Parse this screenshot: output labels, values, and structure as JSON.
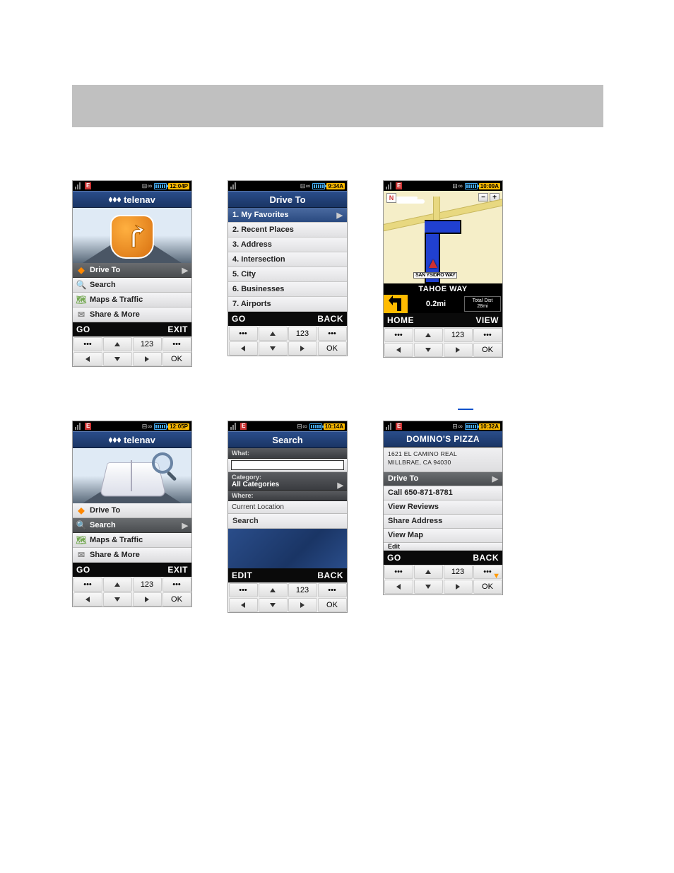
{
  "status": {
    "e_label": "E",
    "dev_icons": "⊟ ∞",
    "times": {
      "p1": "12:04P",
      "p2": "9:34A",
      "p3": "10:09A",
      "p4": "12:05P",
      "p5": "10:14A",
      "p6": "10:32A"
    }
  },
  "brand": "telenav",
  "main_menu": {
    "drive_to": "Drive To",
    "search": "Search",
    "maps": "Maps & Traffic",
    "share": "Share & More"
  },
  "softkeys": {
    "go": "GO",
    "exit": "EXIT",
    "back": "BACK",
    "home": "HOME",
    "view": "VIEW",
    "edit": "EDIT"
  },
  "keypad": {
    "dots": "•••",
    "num": "123",
    "ok": "OK"
  },
  "drive_to_menu": {
    "title": "Drive To",
    "items": [
      "1. My Favorites",
      "2. Recent Places",
      "3. Address",
      "4. Intersection",
      "5. City",
      "6. Businesses",
      "7. Airports"
    ]
  },
  "nav": {
    "north": "N",
    "zoom_out": "−",
    "zoom_in": "+",
    "current_road_label": "SAN YSIDRO WAY",
    "next_street": "TAHOE WAY",
    "next_dist": "0.2mi",
    "total_label": "Total Dist",
    "total_value": "28mi"
  },
  "search_form": {
    "title": "Search",
    "what_label": "What:",
    "what_value": "",
    "category_label": "Category:",
    "category_value": "All Categories",
    "where_label": "Where:",
    "where_value": "Current Location",
    "search_btn": "Search"
  },
  "business": {
    "name": "DOMINO'S PIZZA",
    "addr_line1": "1621 EL CAMINO REAL",
    "addr_line2": "MILLBRAE, CA 94030",
    "drive_to": "Drive To",
    "call": "Call 650-871-8781",
    "reviews": "View Reviews",
    "share": "Share Address",
    "map": "View Map",
    "more": "Edit"
  }
}
